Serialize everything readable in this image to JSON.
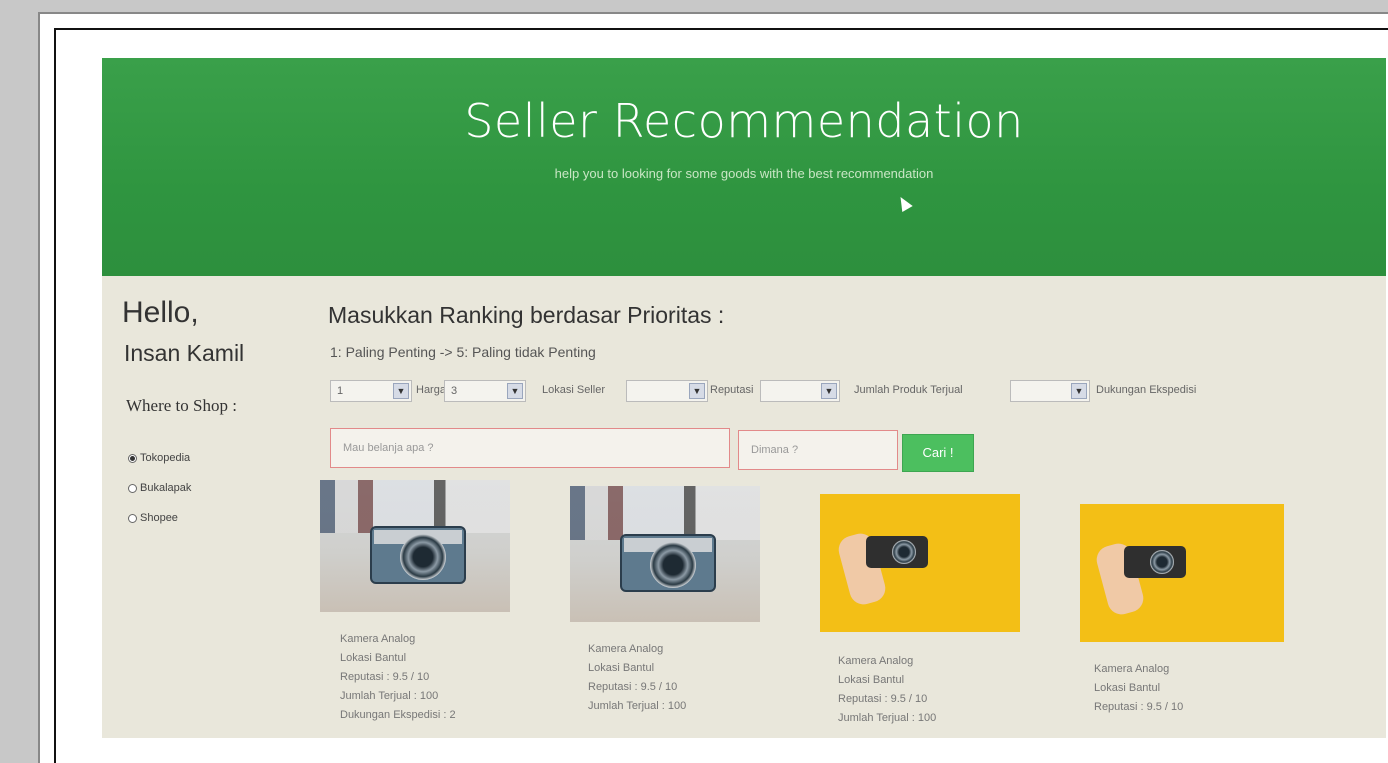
{
  "banner": {
    "title": "Seller Recommendation",
    "subtitle": "help you to looking for some goods with the best recommendation"
  },
  "sidebar": {
    "greeting": "Hello,",
    "username": "Insan Kamil",
    "where_label": "Where to Shop :",
    "shops": [
      {
        "label": "Tokopedia",
        "selected": true
      },
      {
        "label": "Bukalapak",
        "selected": false
      },
      {
        "label": "Shopee",
        "selected": false
      }
    ]
  },
  "ranking": {
    "heading": "Masukkan Ranking berdasar Prioritas :",
    "subheading": "1: Paling Penting -> 5: Paling tidak Penting",
    "criteria": [
      {
        "rank": "1",
        "label": "Harga"
      },
      {
        "rank": "3",
        "label": "Lokasi Seller"
      },
      {
        "rank": "",
        "label": "Reputasi"
      },
      {
        "rank": "",
        "label": "Jumlah Produk Terjual"
      },
      {
        "rank": "",
        "label": "Dukungan Ekspedisi"
      }
    ]
  },
  "search": {
    "query_placeholder": "Mau belanja apa ?",
    "location_placeholder": "Dimana ?",
    "button_label": "Cari !"
  },
  "products": [
    {
      "name": "Kamera Analog",
      "location": "Lokasi Bantul",
      "reputation": "Reputasi : 9.5 / 10",
      "sold": "Jumlah Terjual : 100",
      "shipping": "Dukungan Ekspedisi : 2",
      "image": "camera-grey"
    },
    {
      "name": "Kamera Analog",
      "location": "Lokasi Bantul",
      "reputation": "Reputasi : 9.5 / 10",
      "sold": "Jumlah Terjual : 100",
      "shipping": "",
      "image": "camera-grey"
    },
    {
      "name": "Kamera Analog",
      "location": "Lokasi Bantul",
      "reputation": "Reputasi : 9.5 / 10",
      "sold": "Jumlah Terjual : 100",
      "shipping": "",
      "image": "camera-yellow"
    },
    {
      "name": "Kamera Analog",
      "location": "Lokasi Bantul",
      "reputation": "Reputasi : 9.5 / 10",
      "sold": "",
      "shipping": "",
      "image": "camera-yellow"
    }
  ]
}
